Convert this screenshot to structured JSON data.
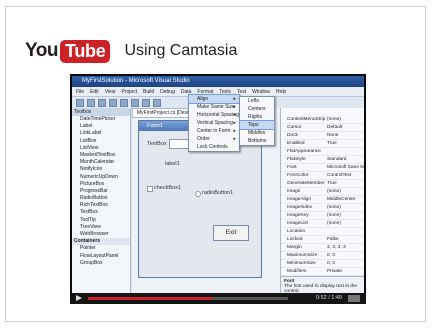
{
  "slide": {
    "logo_you": "You",
    "logo_tube": "Tube",
    "title": "Using Camtasia"
  },
  "vs": {
    "window_title": "MyFirstSolution - Microsoft Visual Studio",
    "menus": [
      "File",
      "Edit",
      "View",
      "Project",
      "Build",
      "Debug",
      "Data",
      "Format",
      "Tools",
      "Test",
      "Window",
      "Help"
    ],
    "toolbox_header": "Toolbox",
    "toolbox_items": [
      "DateTimePicker",
      "Label",
      "LinkLabel",
      "ListBox",
      "ListView",
      "MaskedTextBox",
      "MonthCalendar",
      "NotifyIcon",
      "NumericUpDown",
      "PictureBox",
      "ProgressBar",
      "RadioButton",
      "RichTextBox",
      "TextBox",
      "ToolTip",
      "TreeView",
      "WebBrowser"
    ],
    "toolbox_group": "Containers",
    "toolbox_items2": [
      "Pointer",
      "FlowLayoutPanel",
      "GroupBox"
    ],
    "doc_tab": "MyFirstProject.cs [Design]",
    "form": {
      "title": "Form1",
      "textbox_label": "TextBox",
      "label1": "label1",
      "checkbox": "checkBox1",
      "radio": "radioButton1",
      "exit_button": "Exit"
    },
    "format_menu": [
      "Align",
      "Make Same Size",
      "Horizontal Spacing",
      "Vertical Spacing",
      "Center in Form",
      "Order",
      "Lock Controls"
    ],
    "align_menu": [
      "Lefts",
      "Centers",
      "Rights",
      "Tops",
      "Middles",
      "Bottoms"
    ],
    "align_selected_index": 3,
    "properties": [
      [
        "ContextMenuStrip",
        "(none)"
      ],
      [
        "Cursor",
        "Default"
      ],
      [
        "Dock",
        "None"
      ],
      [
        "Enabled",
        "True"
      ],
      [
        "FlatAppearance",
        ""
      ],
      [
        "FlatStyle",
        "Standard"
      ],
      [
        "Font",
        "Microsoft Sans Serif"
      ],
      [
        "ForeColor",
        "ControlText"
      ],
      [
        "GenerateMember",
        "True"
      ],
      [
        "Image",
        "(none)"
      ],
      [
        "ImageAlign",
        "MiddleCenter"
      ],
      [
        "ImageIndex",
        "(none)"
      ],
      [
        "ImageKey",
        "(none)"
      ],
      [
        "ImageList",
        "(none)"
      ],
      [
        "Location",
        ""
      ],
      [
        "Locked",
        "False"
      ],
      [
        "Margin",
        "3, 3, 3, 3"
      ],
      [
        "MaximumSize",
        "0, 0"
      ],
      [
        "MinimumSize",
        "0, 0"
      ],
      [
        "Modifiers",
        "Private"
      ]
    ],
    "props_footer_title": "Font",
    "props_footer_text": "The font used to display text in the control."
  },
  "player": {
    "progress": 0.62,
    "time": "0:52 / 1:49"
  }
}
